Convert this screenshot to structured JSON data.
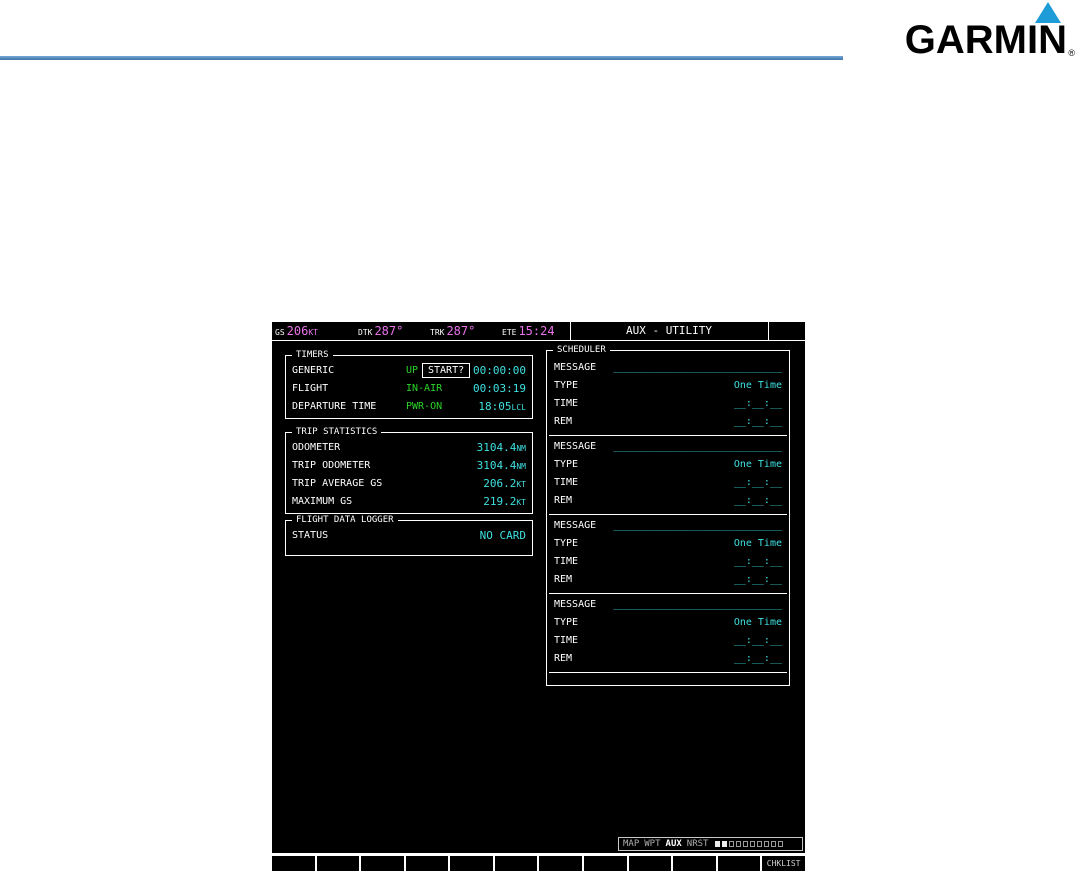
{
  "page": {
    "logo_text": "GARMIN",
    "logo_reg": "®",
    "rule_color": "#4a7fb5",
    "triangle_color": "#1e9cd7"
  },
  "display": {
    "colors": {
      "background": "#000000",
      "magenta": "#e973e9",
      "cyan": "#3fe0e0",
      "green": "#2bd52b",
      "white": "#ffffff",
      "inactive_gray": "#b0b0b0"
    },
    "navbar": {
      "fields": [
        {
          "label": "GS",
          "value": "206",
          "unit": "KT"
        },
        {
          "label": "DTK",
          "value": "287°",
          "unit": ""
        },
        {
          "label": "TRK",
          "value": "287°",
          "unit": ""
        },
        {
          "label": "ETE",
          "value": "15:24",
          "unit": ""
        }
      ],
      "page_title": "AUX - UTILITY"
    },
    "timers": {
      "title": "TIMERS",
      "generic": {
        "label": "GENERIC",
        "mode": "UP",
        "button": "START?",
        "value": "00:00:00"
      },
      "flight": {
        "label": "FLIGHT",
        "mode": "IN-AIR",
        "value": "00:03:19"
      },
      "departure": {
        "label": "DEPARTURE TIME",
        "mode": "PWR-ON",
        "value": "18:05",
        "unit": "LCL"
      }
    },
    "trip_statistics": {
      "title": "TRIP STATISTICS",
      "rows": [
        {
          "label": "ODOMETER",
          "value": "3104.4",
          "unit": "NM"
        },
        {
          "label": "TRIP ODOMETER",
          "value": "3104.4",
          "unit": "NM"
        },
        {
          "label": "TRIP AVERAGE GS",
          "value": "206.2",
          "unit": "KT"
        },
        {
          "label": "MAXIMUM GS",
          "value": "219.2",
          "unit": "KT"
        }
      ]
    },
    "flight_data_logger": {
      "title": "FLIGHT DATA LOGGER",
      "status_label": "STATUS",
      "status_value": "NO CARD"
    },
    "scheduler": {
      "title": "SCHEDULER",
      "labels": {
        "message": "MESSAGE",
        "type": "TYPE",
        "time": "TIME",
        "rem": "REM"
      },
      "entries": [
        {
          "message": "____________________________",
          "type": "One Time",
          "time": "__:__:__",
          "rem": "__:__:__"
        },
        {
          "message": "____________________________",
          "type": "One Time",
          "time": "__:__:__",
          "rem": "__:__:__"
        },
        {
          "message": "____________________________",
          "type": "One Time",
          "time": "__:__:__",
          "rem": "__:__:__"
        },
        {
          "message": "____________________________",
          "type": "One Time",
          "time": "__:__:__",
          "rem": "__:__:__"
        }
      ]
    },
    "pagebar": {
      "groups": [
        {
          "label": "MAP",
          "active": false
        },
        {
          "label": "WPT",
          "active": false
        },
        {
          "label": "AUX",
          "active": true
        },
        {
          "label": "NRST",
          "active": false
        }
      ],
      "page_count": 10,
      "filled_boxes": [
        0,
        1
      ]
    },
    "softkeys": {
      "count": 12,
      "right_label": "CHKLIST"
    }
  }
}
